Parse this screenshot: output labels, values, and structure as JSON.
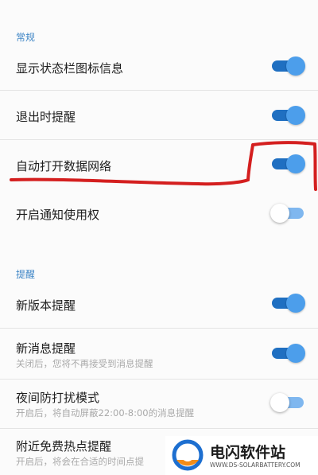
{
  "sections": {
    "general": "常规",
    "reminders": "提醒"
  },
  "settings": {
    "status_bar_icon": {
      "title": "显示状态栏图标信息",
      "enabled": true
    },
    "exit_reminder": {
      "title": "退出时提醒",
      "enabled": true
    },
    "auto_mobile_data": {
      "title": "自动打开数据网络",
      "enabled": true
    },
    "notification_access": {
      "title": "开启通知使用权",
      "enabled": false
    },
    "new_version": {
      "title": "新版本提醒",
      "enabled": true
    },
    "new_message": {
      "title": "新消息提醒",
      "subtitle": "关闭后，您将不再接受到消息提醒",
      "enabled": true
    },
    "night_mode": {
      "title": "夜间防打扰模式",
      "subtitle": "开启后，将自动屏蔽22:00-8:00的消息提醒",
      "enabled": false
    },
    "free_hotspot": {
      "title": "附近免费热点提醒",
      "subtitle": "开启后，将会在合适的时间点提"
    }
  },
  "annotation": {
    "color": "#d41f1f"
  },
  "watermark": {
    "name": "电闪软件站",
    "url": "WWW.DS-SOLARBATTERY.COM"
  },
  "colors": {
    "accent": "#1f6fc1",
    "section_header": "#3f86c6"
  }
}
